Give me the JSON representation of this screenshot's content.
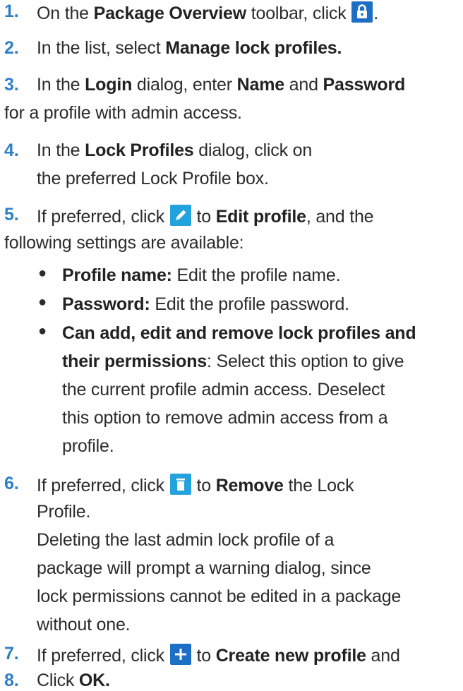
{
  "steps": [
    {
      "num": "1.",
      "parts": {
        "a": "On the ",
        "b": "Package Overview",
        "c": " toolbar, click ",
        "d": "."
      },
      "icon": "lock-icon"
    },
    {
      "num": "2.",
      "parts": {
        "a": "In the list, select ",
        "b": "Manage lock profiles."
      }
    },
    {
      "num": "3.",
      "parts": {
        "a": "In the ",
        "b": "Login",
        "c": " dialog, enter ",
        "d": "Name",
        "e": " and ",
        "f": "Password",
        "g": "for a profile with admin access."
      }
    },
    {
      "num": "4.",
      "parts": {
        "a": "In the ",
        "b": "Lock Profiles",
        "c": " dialog, click on",
        "d": "the preferred Lock Profile box."
      }
    },
    {
      "num": "5.",
      "parts": {
        "a": "If preferred, click ",
        "b": " to ",
        "c": "Edit profile",
        "d": ", and the",
        "e": "following settings are available:"
      },
      "icon": "edit-pencil-icon"
    },
    {
      "num": "6.",
      "parts": {
        "a": "If preferred, click ",
        "b": " to ",
        "c": "Remove",
        "d": " the Lock",
        "e": "Profile.",
        "f": "Deleting the last admin lock profile of a",
        "g": "package will prompt a warning dialog, since",
        "h": "lock permissions cannot be edited in a package",
        "i": "without one."
      },
      "icon": "trash-icon"
    },
    {
      "num": "7.",
      "parts": {
        "a": "If preferred, click ",
        "b": " to ",
        "c": "Create new profile",
        "d": " and"
      },
      "icon": "plus-icon"
    },
    {
      "num": "8.",
      "parts": {
        "a": "Click ",
        "b": "OK."
      }
    }
  ],
  "bullets": [
    {
      "label": "Profile name:",
      "text": " Edit the profile name."
    },
    {
      "label": "Password:",
      "text": " Edit the profile password."
    },
    {
      "label1": "Can add, edit and remove lock profiles and",
      "label2": "their permissions",
      "text1": ": Select this option to give",
      "text2": "the current profile admin access. Deselect",
      "text3": "this option to remove admin access from a",
      "text4": "profile."
    }
  ],
  "colors": {
    "accent": "#2e7fc9",
    "icon_blue": "#1c6fc4",
    "icon_cyan": "#23a3dd",
    "text": "#2b2b2b"
  }
}
